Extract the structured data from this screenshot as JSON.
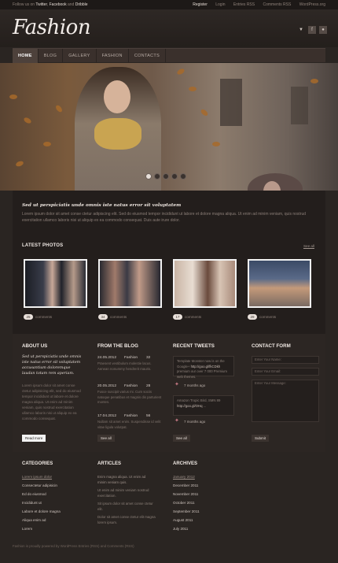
{
  "topbar": {
    "follow_prefix": "Follow us on",
    "twitter": "Twitter",
    "facebook": "Facebook",
    "and": "and",
    "dribble": "Dribble",
    "links": [
      "Register",
      "Login",
      "Entries RSS",
      "Comments RSS",
      "WordPress.org"
    ]
  },
  "header": {
    "logo": "Fashion",
    "social_icons": [
      "bird-icon",
      "facebook-icon",
      "flickr-icon"
    ]
  },
  "nav": {
    "items": [
      "HOME",
      "BLOG",
      "GALLERY",
      "FASHION",
      "CONTACTS"
    ],
    "active": "HOME"
  },
  "slider": {
    "dots": 5,
    "active_dot": 1
  },
  "intro": {
    "title": "Sed ut perspiciatis unde omnis iste natus error sit voluptatem",
    "text": "Lorem ipsum dolor sit amet conse ctetur adipiscing elit. Sed do eiusmod tempor incididunt ut labore et dolore magna aliqua. Ut enim ad minim veniam, quis nostrud exercitation ullamco laboris nisi ut aliquip ex ea commodo consequat. Duis aute irure dolor."
  },
  "photos": {
    "title": "LATEST PHOTOS",
    "see_all": "See all",
    "items": [
      {
        "count": "25",
        "label": "comments"
      },
      {
        "count": "34",
        "label": "comments"
      },
      {
        "count": "17",
        "label": "comments"
      },
      {
        "count": "29",
        "label": "comments"
      }
    ]
  },
  "about": {
    "title": "ABOUT US",
    "lead": "Sed ut perspiciatis unde omnis iste natus error sit voluptatem accusantium doloremque laudan totam rem aperiam.",
    "body": "Lorem ipsum dolor sit amet conse ctetur adipisicing elit, sed do eiusmod tempor incididunt ut labore et dolore magna aliqua. Ut enim ad minim veniam, quis nostrud exercitation ullamco laboris nisi ut aliquip ex ea commodo consequat.",
    "button": "Read more"
  },
  "blog": {
    "title": "FROM THE BLOG",
    "posts": [
      {
        "date": "24.05.2012",
        "cat": "Fashion",
        "num": "32",
        "excerpt": "Praesent vestibulum molestie lacus. Aenean nonummy hendrerit mauris."
      },
      {
        "date": "20.05.2012",
        "cat": "Fashion",
        "num": "28",
        "excerpt": "Fusce suscipit varius mi. Cum sociis natoque penatibus et magnis dis parturient montes."
      },
      {
        "date": "17.04.2012",
        "cat": "Fashion",
        "num": "56",
        "excerpt": "Nullam sit amet enim. Suspendisse id velit vitae ligula volutpat."
      }
    ],
    "button": "See all"
  },
  "tweets": {
    "title": "RECENT TWEETS",
    "items": [
      {
        "text": "Template Monster now is on the Google+ ",
        "link": "http://goo.gl/fkCDkh",
        "text2": " premium our over 7 000 Premium web themes.",
        "ago": "7 months ago"
      },
      {
        "text": "Amazon Tropic Bird, SMN 89 ",
        "link": "http://goo.gl/OHq",
        "text2": " ...",
        "ago": "7 months ago"
      }
    ],
    "button": "See all"
  },
  "contact": {
    "title": "CONTACT FORM",
    "name_placeholder": "Enter Your Name:",
    "email_placeholder": "Enter Your Email:",
    "message_placeholder": "Enter Your Message:",
    "button": "Submit"
  },
  "footer": {
    "categories": {
      "title": "CATEGORIES",
      "items": [
        "Lorem ipsum dolor",
        "Consectetur adipisicin",
        "Ed do eiusmod",
        "Incididunt ut",
        "Labore et dolore magna",
        "Aliqua enim ad",
        "Lorem"
      ]
    },
    "articles": {
      "title": "ARTICLES",
      "items": [
        "Enim magna aliqua. Ut enim ad minim veniam quis.",
        "Ut enim ad minim veniam nostrud exercitation.",
        "Sit ipsum dolor sit amet conse ctetur elit.",
        "Dolor sit amet conse ctetur elit magna lorem ipsum."
      ]
    },
    "archives": {
      "title": "ARCHIVES",
      "items": [
        "January 2012",
        "December 2011",
        "November 2011",
        "October 2011",
        "September 2011",
        "August 2011",
        "July 2011"
      ]
    }
  },
  "copyright": "Fashion is proudly powered by WordPress Entries (RSS) and Comments (RSS)"
}
